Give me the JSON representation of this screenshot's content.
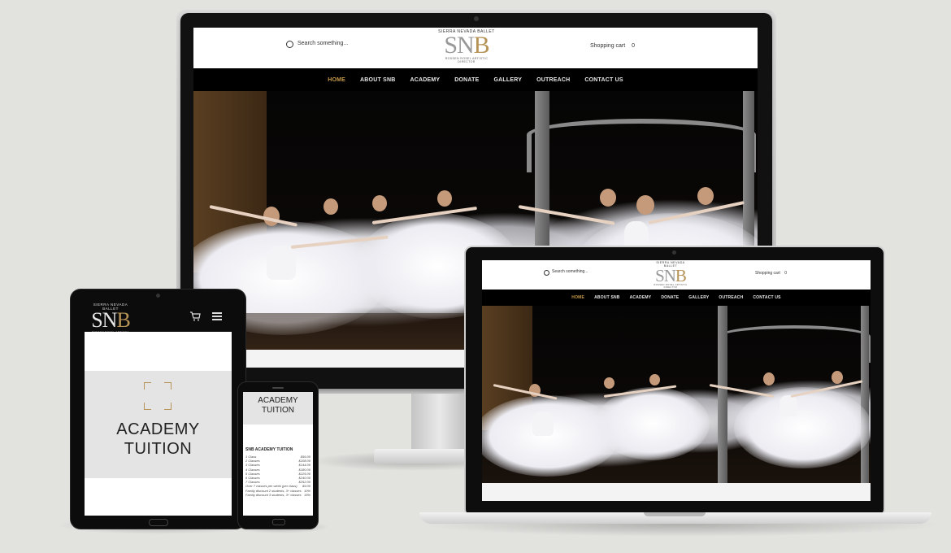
{
  "site": {
    "search_placeholder": "Search something...",
    "cart_label": "Shopping cart",
    "cart_count": "0",
    "logo_top": "SIERRA NEVADA BALLET",
    "logo_sn": "SN",
    "logo_b": "B",
    "logo_sub": "ROSSEN ROSEL ARTISTIC DIRECTOR",
    "nav": [
      "HOME",
      "ABOUT SNB",
      "ACADEMY",
      "DONATE",
      "GALLERY",
      "OUTREACH",
      "CONTACT US"
    ],
    "nav_active_color": "#c59a4a",
    "brand_gold": "#b69356"
  },
  "tablet": {
    "logo_top": "SIERRA NEVADA BALLET",
    "logo_sn": "SN",
    "logo_b": "B",
    "logo_sub": "ROSSEN ROSEL ARTISTIC DIRECTOR",
    "cart_icon": "cart-icon",
    "menu_icon": "hamburger-menu-icon",
    "heading_line1": "ACADEMY",
    "heading_line2": "TUITION"
  },
  "phone": {
    "heading_line1": "ACADEMY",
    "heading_line2": "TUITION",
    "section_title": "SNB ACADEMY TUITION",
    "rows": [
      {
        "label": "1 Class",
        "value": "$56.00"
      },
      {
        "label": "2 Classes",
        "value": "$108.00"
      },
      {
        "label": "3 Classes",
        "value": "$144.00"
      },
      {
        "label": "4 Classes",
        "value": "$180.00"
      },
      {
        "label": "5 Classes",
        "value": "$225.00"
      },
      {
        "label": "6 Classes",
        "value": "$240.00"
      },
      {
        "label": "7 Classes",
        "value": "$252.00"
      },
      {
        "label": "Over 7 classes per week (per class)",
        "value": "$9.00"
      },
      {
        "label": "Family discount 2 students, 3+ classes",
        "value": "10%"
      },
      {
        "label": "Family discount 3 students, 3+ classes",
        "value": "15%"
      }
    ]
  }
}
